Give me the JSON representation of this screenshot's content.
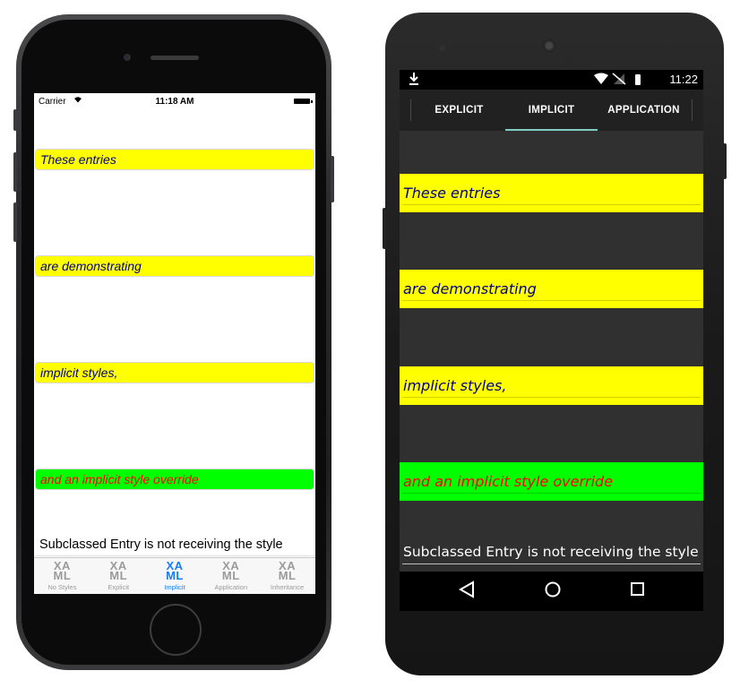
{
  "ios": {
    "status": {
      "carrier": "Carrier",
      "time": "11:18 AM"
    },
    "entries": [
      {
        "text": "These entries",
        "bg": "#ffff00",
        "color": "#000080"
      },
      {
        "text": "are demonstrating",
        "bg": "#ffff00",
        "color": "#000080"
      },
      {
        "text": "implicit styles,",
        "bg": "#ffff00",
        "color": "#000080"
      },
      {
        "text": "and an implicit style override",
        "bg": "#00ff00",
        "color": "#ff0000"
      }
    ],
    "subclassed_entry": "Subclassed Entry is not receiving the style",
    "tabs": [
      {
        "icon": "XAML",
        "icon_top": "XA",
        "icon_bottom": "ML",
        "label": "No Styles",
        "active": false
      },
      {
        "icon": "XAML",
        "icon_top": "XA",
        "icon_bottom": "ML",
        "label": "Explicit",
        "active": false
      },
      {
        "icon": "XAML",
        "icon_top": "XA",
        "icon_bottom": "ML",
        "label": "Implicit",
        "active": true
      },
      {
        "icon": "XAML",
        "icon_top": "XA",
        "icon_bottom": "ML",
        "label": "Application",
        "active": false
      },
      {
        "icon": "XAML",
        "icon_top": "XA",
        "icon_bottom": "ML",
        "label": "Inheritance",
        "active": false
      }
    ]
  },
  "android": {
    "status": {
      "time": "11:22"
    },
    "tabs": [
      {
        "label": "EXPLICIT",
        "active": false
      },
      {
        "label": "IMPLICIT",
        "active": true
      },
      {
        "label": "APPLICATION",
        "active": false
      }
    ],
    "entries": [
      {
        "text": "These entries",
        "bg": "#ffff00",
        "color": "#000080"
      },
      {
        "text": "are demonstrating",
        "bg": "#ffff00",
        "color": "#000080"
      },
      {
        "text": "implicit styles,",
        "bg": "#ffff00",
        "color": "#000080"
      },
      {
        "text": "and an implicit style override",
        "bg": "#00ff00",
        "color": "#ff0000"
      }
    ],
    "subclassed_entry": "Subclassed Entry is not receiving the style",
    "nav": {
      "back_icon": "back-triangle-icon",
      "home_icon": "home-circle-icon",
      "recents_icon": "recents-square-icon"
    }
  },
  "colors": {
    "ios_accent": "#1a7cf5",
    "android_tab_indicator": "#80cbc4",
    "android_background": "#303030"
  }
}
